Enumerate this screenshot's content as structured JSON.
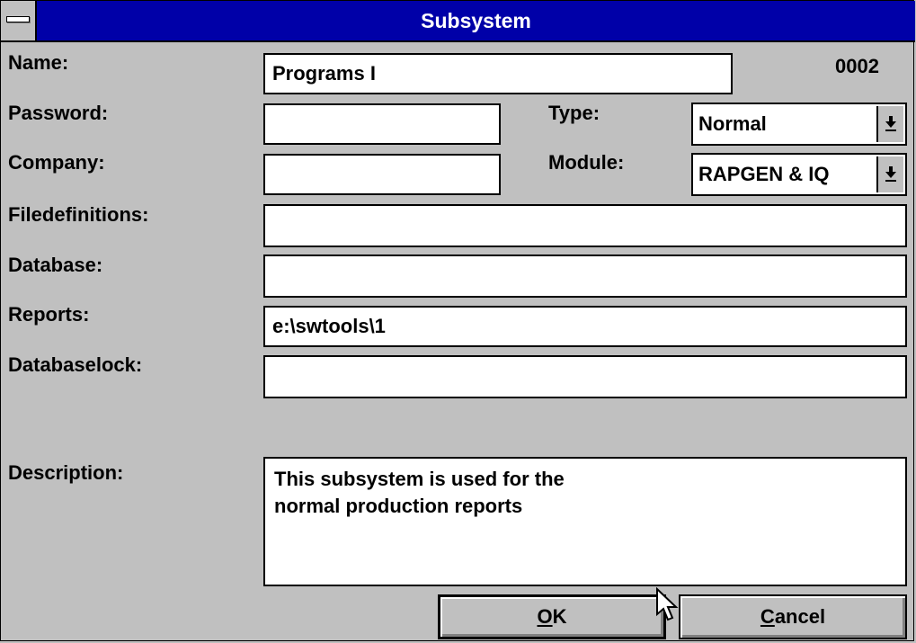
{
  "window": {
    "title": "Subsystem"
  },
  "record_number": "0002",
  "fields": {
    "name": {
      "label": "Name:",
      "value": "Programs I"
    },
    "password": {
      "label": "Password:",
      "value": ""
    },
    "company": {
      "label": "Company:",
      "value": ""
    },
    "filedefinitions": {
      "label": "Filedefinitions:",
      "value": ""
    },
    "database": {
      "label": "Database:",
      "value": ""
    },
    "reports": {
      "label": "Reports:",
      "value": "e:\\swtools\\1"
    },
    "databaselock": {
      "label": "Databaselock:",
      "value": ""
    },
    "type": {
      "label": "Type:",
      "value": "Normal"
    },
    "module": {
      "label": "Module:",
      "value": "RAPGEN & IQ"
    },
    "description": {
      "label": "Description:",
      "lines": [
        "This subsystem is used for the",
        "normal production reports"
      ]
    }
  },
  "buttons": {
    "ok": {
      "mnemonic": "O",
      "rest": "K"
    },
    "cancel": {
      "mnemonic": "C",
      "rest": "ancel"
    }
  },
  "icons": {
    "system_menu": "system-menu-icon",
    "dropdown": "dropdown-arrow-icon",
    "cursor": "mouse-pointer-icon"
  },
  "colors": {
    "title_bar": "#0000a8",
    "dialog_background": "#c0c0c0",
    "field_background": "#ffffff"
  }
}
